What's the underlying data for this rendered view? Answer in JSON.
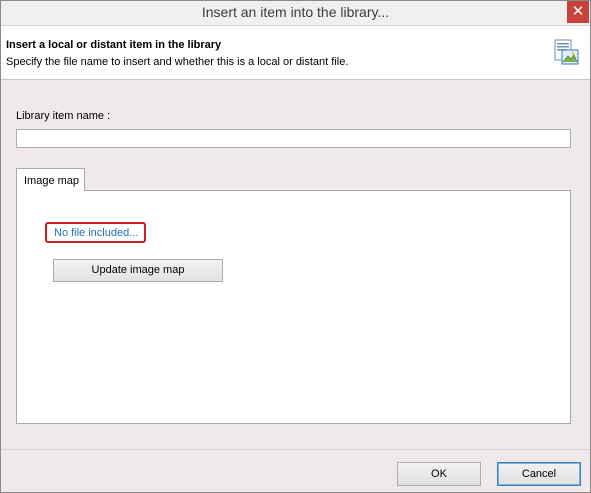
{
  "window": {
    "title": "Insert an item into the library...",
    "close_glyph": "✕"
  },
  "header": {
    "title": "Insert a local or distant item in the library",
    "subtitle": "Specify the file name to insert and whether this is a local or distant file.",
    "icon": "library-image-icon"
  },
  "library_item": {
    "label": "Library item name :",
    "value": "",
    "placeholder": ""
  },
  "tabs": [
    {
      "label": "Image map"
    }
  ],
  "image_map": {
    "file_status": "No file included...",
    "update_label": "Update image map"
  },
  "buttons": {
    "ok_label": "OK",
    "cancel_label": "Cancel"
  },
  "colors": {
    "link": "#1c6fb6",
    "highlight_border": "#cc1f1f",
    "close_button": "#c7423a"
  }
}
